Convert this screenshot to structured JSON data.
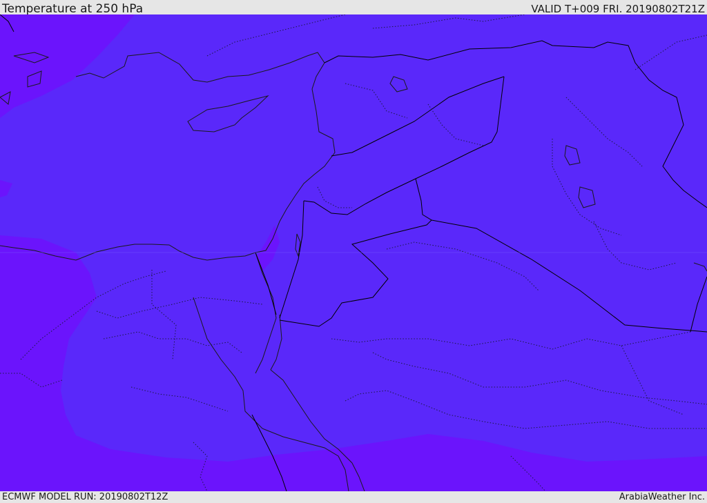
{
  "header": {
    "title": "Temperature at 250 hPa",
    "valid": "VALID T+009 FRI. 20190802T21Z"
  },
  "footer": {
    "model_run": "ECMWF MODEL RUN: 20190802T12Z",
    "credit": "ArabiaWeather Inc."
  },
  "map": {
    "colors": {
      "field_main": "#5a28fa",
      "field_warm": "#6b14fc",
      "borders": "#000000",
      "coast": "#1a1a1a"
    }
  }
}
